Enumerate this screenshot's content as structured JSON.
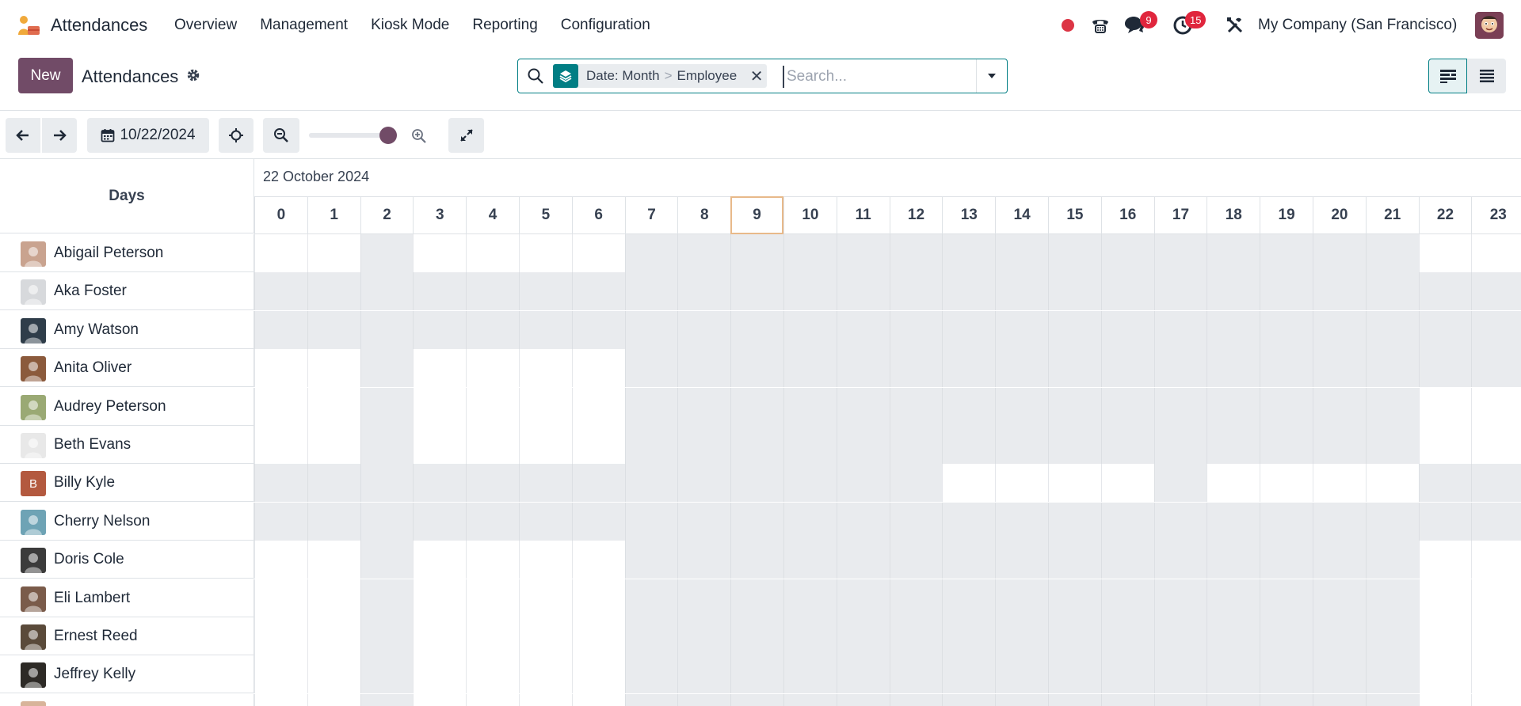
{
  "app": {
    "name": "Attendances",
    "logo_icon": "attendances-logo-icon"
  },
  "menu": [
    "Overview",
    "Management",
    "Kiosk Mode",
    "Reporting",
    "Configuration"
  ],
  "systray": {
    "chat_badge": "9",
    "activity_badge": "15",
    "company": "My Company (San Francisco)"
  },
  "control": {
    "new_label": "New",
    "title": "Attendances"
  },
  "search": {
    "facet_group": "Date: Month",
    "facet_sep": ">",
    "facet_field": "Employee",
    "facet_remove": "✕",
    "placeholder": "Search..."
  },
  "toolbar": {
    "date": "10/22/2024",
    "zoom_level": 1.0
  },
  "gantt": {
    "left_header": "Days",
    "date_title": "22 October 2024",
    "hours": [
      "0",
      "1",
      "2",
      "3",
      "4",
      "5",
      "6",
      "7",
      "8",
      "9",
      "10",
      "11",
      "12",
      "13",
      "14",
      "15",
      "16",
      "17",
      "18",
      "19",
      "20",
      "21",
      "22",
      "23"
    ],
    "current_hour": "9",
    "rows": [
      {
        "name": "Abigail Peterson",
        "avatar_color": "#c9a38f",
        "initial": "",
        "working_hours": [
          0,
          1,
          3,
          4,
          5,
          6,
          22,
          23
        ]
      },
      {
        "name": "Aka Foster",
        "avatar_color": "#d7d9dc",
        "initial": "",
        "working_hours": []
      },
      {
        "name": "Amy Watson",
        "avatar_color": "#2f3d4a",
        "initial": "",
        "working_hours": []
      },
      {
        "name": "Anita Oliver",
        "avatar_color": "#8b5a3c",
        "initial": "",
        "working_hours": [
          0,
          1,
          3,
          4,
          5,
          6
        ]
      },
      {
        "name": "Audrey Peterson",
        "avatar_color": "#9aa974",
        "initial": "",
        "working_hours": [
          0,
          1,
          3,
          4,
          5,
          6,
          22,
          23
        ]
      },
      {
        "name": "Beth Evans",
        "avatar_color": "#e8e8e8",
        "initial": "",
        "working_hours": [
          0,
          1,
          3,
          4,
          5,
          6,
          22,
          23
        ]
      },
      {
        "name": "Billy Kyle",
        "avatar_color": "#b3593f",
        "initial": "B",
        "working_hours": [
          13,
          14,
          15,
          16,
          18,
          19,
          20,
          21
        ]
      },
      {
        "name": "Cherry Nelson",
        "avatar_color": "#6ea3b5",
        "initial": "",
        "working_hours": []
      },
      {
        "name": "Doris Cole",
        "avatar_color": "#3b3b3b",
        "initial": "",
        "working_hours": [
          0,
          1,
          3,
          4,
          5,
          6,
          22,
          23
        ]
      },
      {
        "name": "Eli Lambert",
        "avatar_color": "#7a5b4a",
        "initial": "",
        "working_hours": [
          0,
          1,
          3,
          4,
          5,
          6,
          22,
          23
        ]
      },
      {
        "name": "Ernest Reed",
        "avatar_color": "#5a4a3a",
        "initial": "",
        "working_hours": [
          0,
          1,
          3,
          4,
          5,
          6,
          22,
          23
        ]
      },
      {
        "name": "Jeffrey Kelly",
        "avatar_color": "#2d2a26",
        "initial": "",
        "working_hours": [
          0,
          1,
          3,
          4,
          5,
          6,
          22,
          23
        ]
      },
      {
        "name": "",
        "avatar_color": "#d8b49a",
        "initial": "",
        "working_hours": [
          0,
          1,
          3,
          4,
          5,
          6,
          22,
          23
        ]
      }
    ]
  }
}
